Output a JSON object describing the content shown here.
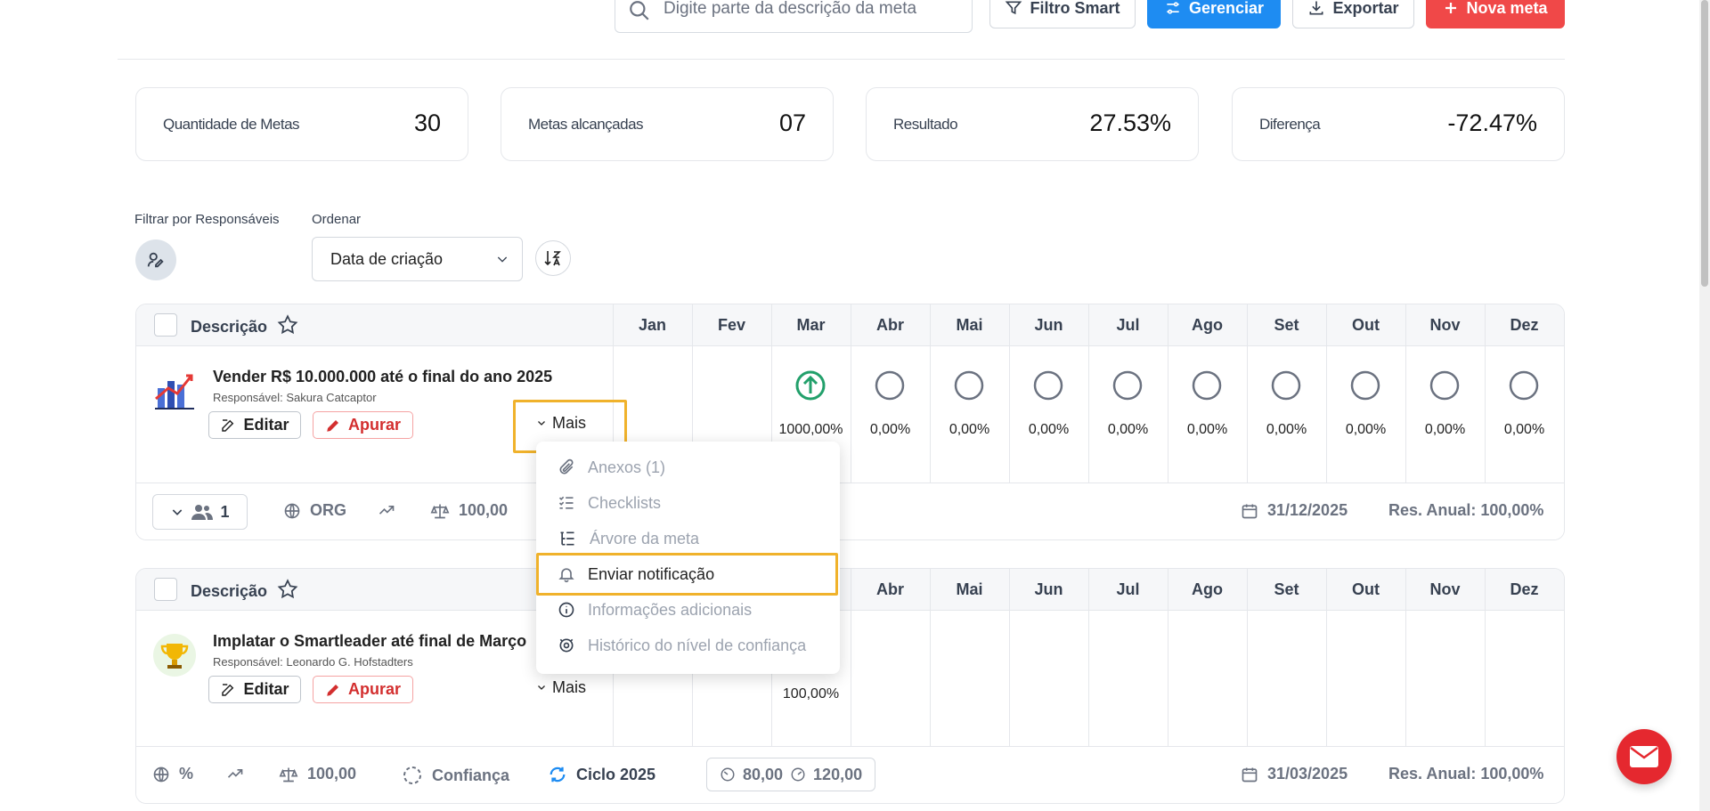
{
  "toolbar": {
    "search_placeholder": "Digite parte da descrição da meta",
    "smart_filter": "Filtro Smart",
    "manage": "Gerenciar",
    "export": "Exportar",
    "new_goal": "Nova meta"
  },
  "stats": [
    {
      "label": "Quantidade de Metas",
      "value": "30"
    },
    {
      "label": "Metas alcançadas",
      "value": "07"
    },
    {
      "label": "Resultado",
      "value": "27.53%"
    },
    {
      "label": "Diferença",
      "value": "-72.47%"
    }
  ],
  "filters": {
    "responsible_label": "Filtrar por Responsáveis",
    "order_label": "Ordenar",
    "order_value": "Data de criação"
  },
  "months": [
    "Jan",
    "Fev",
    "Mar",
    "Abr",
    "Mai",
    "Jun",
    "Jul",
    "Ago",
    "Set",
    "Out",
    "Nov",
    "Dez"
  ],
  "goals": [
    {
      "header_description": "Descrição",
      "title": "Vender R$ 10.000.000 até o final do ano 2025",
      "responsible": "Responsável: Sakura Catcaptor",
      "edit": "Editar",
      "apurar": "Apurar",
      "more": "Mais",
      "month_values": [
        "",
        "",
        "1000,00%",
        "0,00%",
        "0,00%",
        "0,00%",
        "0,00%",
        "0,00%",
        "0,00%",
        "0,00%",
        "0,00%",
        "0,00%"
      ],
      "footer": {
        "team_count": "1",
        "scope": "ORG",
        "weight": "100,00",
        "due_date": "31/12/2025",
        "annual_result": "Res. Anual: 100,00%"
      }
    },
    {
      "header_description": "Descrição",
      "title": "Implatar o Smartleader até final de Março",
      "responsible": "Responsável: Leonardo G. Hofstadters",
      "edit": "Editar",
      "apurar": "Apurar",
      "more": "Mais",
      "month_values": [
        "",
        "",
        "100,00%",
        "",
        "",
        "",
        "",
        "",
        "",
        "",
        "",
        ""
      ],
      "footer": {
        "unit": "%",
        "weight": "100,00",
        "confidence": "Confiança",
        "cycle": "Ciclo 2025",
        "range_min": "80,00",
        "range_max": "120,00",
        "due_date": "31/03/2025",
        "annual_result": "Res. Anual: 100,00%"
      }
    }
  ],
  "more_menu": {
    "items": [
      {
        "label": "Anexos (1)",
        "icon": "paperclip-icon"
      },
      {
        "label": "Checklists",
        "icon": "checklist-icon"
      },
      {
        "label": "Árvore da meta",
        "icon": "tree-icon"
      },
      {
        "label": "Enviar notificação",
        "icon": "bell-icon"
      },
      {
        "label": "Informações adicionais",
        "icon": "info-icon"
      },
      {
        "label": "Histórico do nível de confiança",
        "icon": "history-icon"
      }
    ]
  },
  "colors": {
    "primary": "#1e8cf2",
    "danger": "#f04848",
    "highlight": "#f0b22b",
    "success": "#22a06b"
  }
}
